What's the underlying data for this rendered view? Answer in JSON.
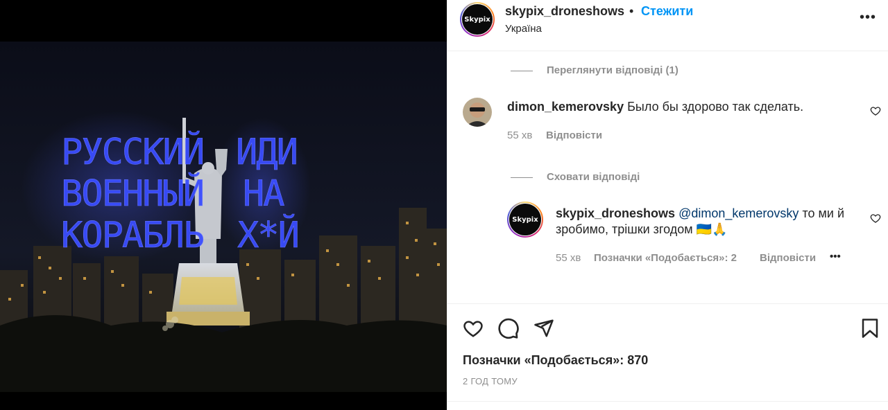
{
  "post": {
    "photo_alt": "Drone show over the Motherland Monument at night",
    "overlay_text": {
      "left_lines": [
        "РУССКИЙ",
        "ВОЕННЫЙ",
        "КОРАБЛЬ"
      ],
      "right_lines": [
        "ИДИ",
        "НА",
        "Х*Й"
      ]
    }
  },
  "header": {
    "avatar_text": "Skypix",
    "username": "skypix_droneshows",
    "separator": "•",
    "follow_label": "Стежити",
    "location": "Україна",
    "more_label": "•••"
  },
  "comments": {
    "view_replies": "Переглянути відповіді (1)",
    "comment1": {
      "username": "dimon_kemerovsky",
      "text": "Было бы здорово так сделать.",
      "time": "55 хв",
      "reply_label": "Відповісти"
    },
    "hide_replies": "Сховати відповіді",
    "reply1": {
      "username": "skypix_droneshows",
      "mention": "@dimon_kemerovsky",
      "text_line1": "то ми й",
      "text_line2": "зробимо, трішки згодом 🇺🇦🙏",
      "time": "55 хв",
      "likes_label": "Позначки «Подобається»: 2",
      "reply_label": "Відповісти",
      "more_label": "•••"
    }
  },
  "footer": {
    "likes": "Позначки «Подобається»: 870",
    "posted": "2 ГОД ТОМУ"
  },
  "colors": {
    "link_blue": "#0095f6",
    "mention_blue": "#00376b",
    "secondary_text": "#8e8e8e",
    "drone_blue": "#3a4dff"
  }
}
